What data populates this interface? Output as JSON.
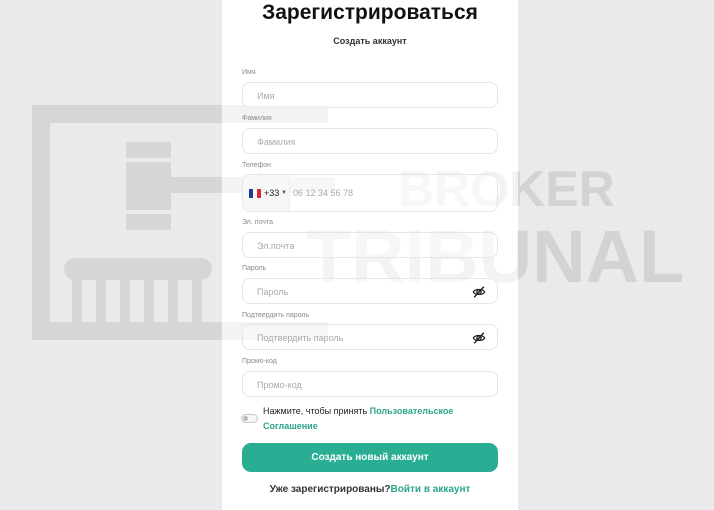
{
  "form": {
    "title": "Зарегистрироваться",
    "subtitle": "Создать аккаунт",
    "fields": [
      {
        "label": "Имя",
        "placeholder": "Имя"
      },
      {
        "label": "Фамилия",
        "placeholder": "Фамилия"
      },
      {
        "label": "Телефон",
        "country_code": "+33",
        "placeholder": "06 12 34 56 78"
      },
      {
        "label": "Эл. почта",
        "placeholder": "Эл.почта"
      },
      {
        "label": "Пароль",
        "placeholder": "Пароль"
      },
      {
        "label": "Подтвердить пароль",
        "placeholder": "Подтвердить пароль"
      },
      {
        "label": "Промо-код",
        "placeholder": "Промо-код"
      }
    ],
    "consent": {
      "text": "Нажмите, чтобы принять ",
      "link": "Пользовательское Соглашение",
      "checked": false
    },
    "submit_label": "Создать новый аккаунт",
    "login_prompt": "Уже зарегистрированы?",
    "login_link": "Войти в аккаунт"
  },
  "watermark": {
    "line1": "BROKER",
    "line2": "TRIBUNAL"
  },
  "colors": {
    "accent": "#2aae93",
    "link": "#2aa58a",
    "watermark": "#d6d6d6",
    "flag_blue": "#1f3c99",
    "flag_red": "#d8283a"
  },
  "icons": {
    "password_toggle": "eye-slash-icon",
    "country_flag": "france-flag-icon",
    "watermark_logo": "gavel-column-icon"
  }
}
